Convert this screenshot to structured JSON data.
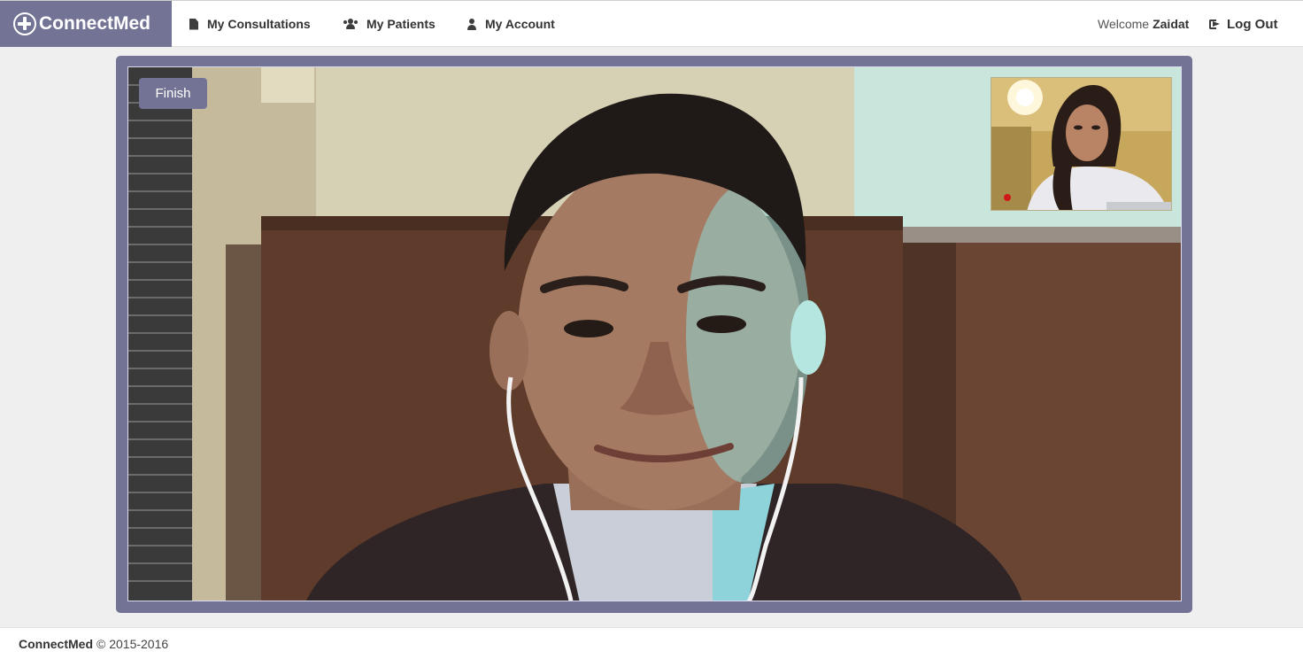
{
  "brand": {
    "name": "ConnectMed",
    "color": "#737395"
  },
  "nav": {
    "items": [
      {
        "label": "My Consultations",
        "icon": "file-icon"
      },
      {
        "label": "My Patients",
        "icon": "users-icon"
      },
      {
        "label": "My Account",
        "icon": "user-icon"
      }
    ],
    "welcome_prefix": "Welcome",
    "welcome_user": "Zaidat",
    "logout_label": "Log Out",
    "logout_icon": "sign-out-icon"
  },
  "call": {
    "finish_label": "Finish",
    "remote_video": "remote participant video",
    "self_video": "self view video"
  },
  "footer": {
    "brand": "ConnectMed",
    "copyright": "© 2015-2016"
  }
}
